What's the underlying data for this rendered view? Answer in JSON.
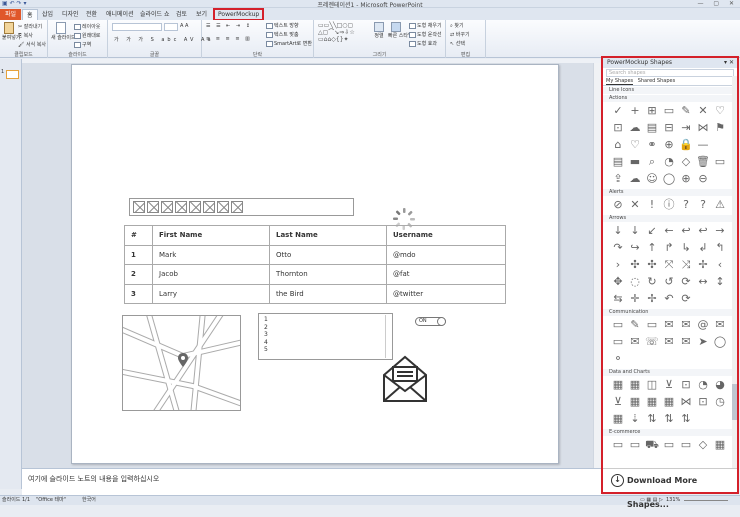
{
  "window": {
    "title": "프레젠테이션1 - Microsoft PowerPoint",
    "quick_access": "▣ ↶ ↷ ▾",
    "controls": "— ▢ ✕"
  },
  "tabs": [
    "파일",
    "홈",
    "삽입",
    "디자인",
    "전환",
    "애니메이션",
    "슬라이드 쇼",
    "검토",
    "보기",
    "PowerMockup"
  ],
  "ribbon": {
    "clipboard": {
      "label": "클립보드",
      "paste": "붙여넣기",
      "cut": "잘라내기",
      "copy": "복사",
      "format_painter": "서식 복사"
    },
    "slides": {
      "label": "슬라이드",
      "new_slide": "새 슬라이드",
      "layout": "레이아웃",
      "reset": "원래대로",
      "section": "구역"
    },
    "font": {
      "label": "글꼴"
    },
    "paragraph": {
      "label": "단락",
      "text_dir": "텍스트 방향",
      "align_text": "텍스트 맞춤",
      "smartart": "SmartArt로 변환"
    },
    "drawing": {
      "label": "그리기",
      "arrange": "정렬",
      "quick_styles": "빠른 스타일",
      "fill": "도형 채우기",
      "outline": "도형 윤곽선",
      "effects": "도형 효과"
    },
    "editing": {
      "label": "편집",
      "find": "찾기",
      "replace": "바꾸기",
      "select": "선택"
    }
  },
  "slide_number": "1",
  "table": {
    "headers": [
      "#",
      "First Name",
      "Last Name",
      "Username"
    ],
    "rows": [
      [
        "1",
        "Mark",
        "Otto",
        "@mdo"
      ],
      [
        "2",
        "Jacob",
        "Thornton",
        "@fat"
      ],
      [
        "3",
        "Larry",
        "the Bird",
        "@twitter"
      ]
    ]
  },
  "listbox": {
    "items": [
      "1",
      "2",
      "3",
      "4",
      "5"
    ]
  },
  "toggle": {
    "label": "ON"
  },
  "notes_placeholder": "여기에 슬라이드 노트의 내용을 입력하십시오",
  "status": {
    "slide": "슬라이드 1/1",
    "theme": "\"Office 테마\"",
    "lang": "한국어",
    "zoom": "131%"
  },
  "panel": {
    "title": "PowerMockup Shapes",
    "search_placeholder": "Search shapes",
    "tabs": [
      "My Shapes",
      "Shared Shapes"
    ],
    "categories": [
      {
        "name": "Line Icons",
        "icons": []
      },
      {
        "name": "Actions",
        "icons": [
          "✓",
          "+",
          "⊞",
          "▭",
          "✎",
          "✕",
          "♡",
          "⊡",
          "☁",
          "▤",
          "⊟",
          "⇥",
          "⋈",
          "⚑",
          "⌂",
          "♡",
          "⚭",
          "⊕",
          "🔒",
          "—",
          "",
          "▤",
          "▬",
          "⌕",
          "◔",
          "◇",
          "🗑",
          "▭",
          "⇪",
          "☁",
          "☺",
          "◯",
          "⊕",
          "⊖",
          ""
        ]
      },
      {
        "name": "Alerts",
        "icons": [
          "⊘",
          "✕",
          "!",
          "ⓘ",
          "?",
          "?",
          "⚠"
        ]
      },
      {
        "name": "Arrows",
        "icons": [
          "↓",
          "↓",
          "↙",
          "←",
          "↩",
          "↩",
          "→",
          "↷",
          "↪",
          "↑",
          "↱",
          "↳",
          "↲",
          "↰",
          "›",
          "✣",
          "✣",
          "⤧",
          "⤨",
          "✢",
          "‹",
          "✥",
          "◌",
          "↻",
          "↺",
          "⟳",
          "↔",
          "↕",
          "⇆",
          "✛",
          "✢",
          "↶",
          "⟳",
          "",
          ""
        ]
      },
      {
        "name": "Communication",
        "icons": [
          "▭",
          "✎",
          "▭",
          "✉",
          "✉",
          "@",
          "✉",
          "▭",
          "✉",
          "☏",
          "✉",
          "✉",
          "➤",
          "◯",
          "⚬"
        ]
      },
      {
        "name": "Data and Charts",
        "icons": [
          "▦",
          "▦",
          "◫",
          "⊻",
          "⊡",
          "◔",
          "◕",
          "⊻",
          "▦",
          "▦",
          "▦",
          "⋈",
          "⊡",
          "◷",
          "▦",
          "⇣",
          "⇅",
          "⇅",
          "⇅",
          "",
          ""
        ]
      },
      {
        "name": "E-commerce",
        "icons": [
          "▭",
          "▭",
          "⛟",
          "▭",
          "▭",
          "◇",
          "▦"
        ]
      }
    ],
    "download_label": "Download More Shapes..."
  }
}
